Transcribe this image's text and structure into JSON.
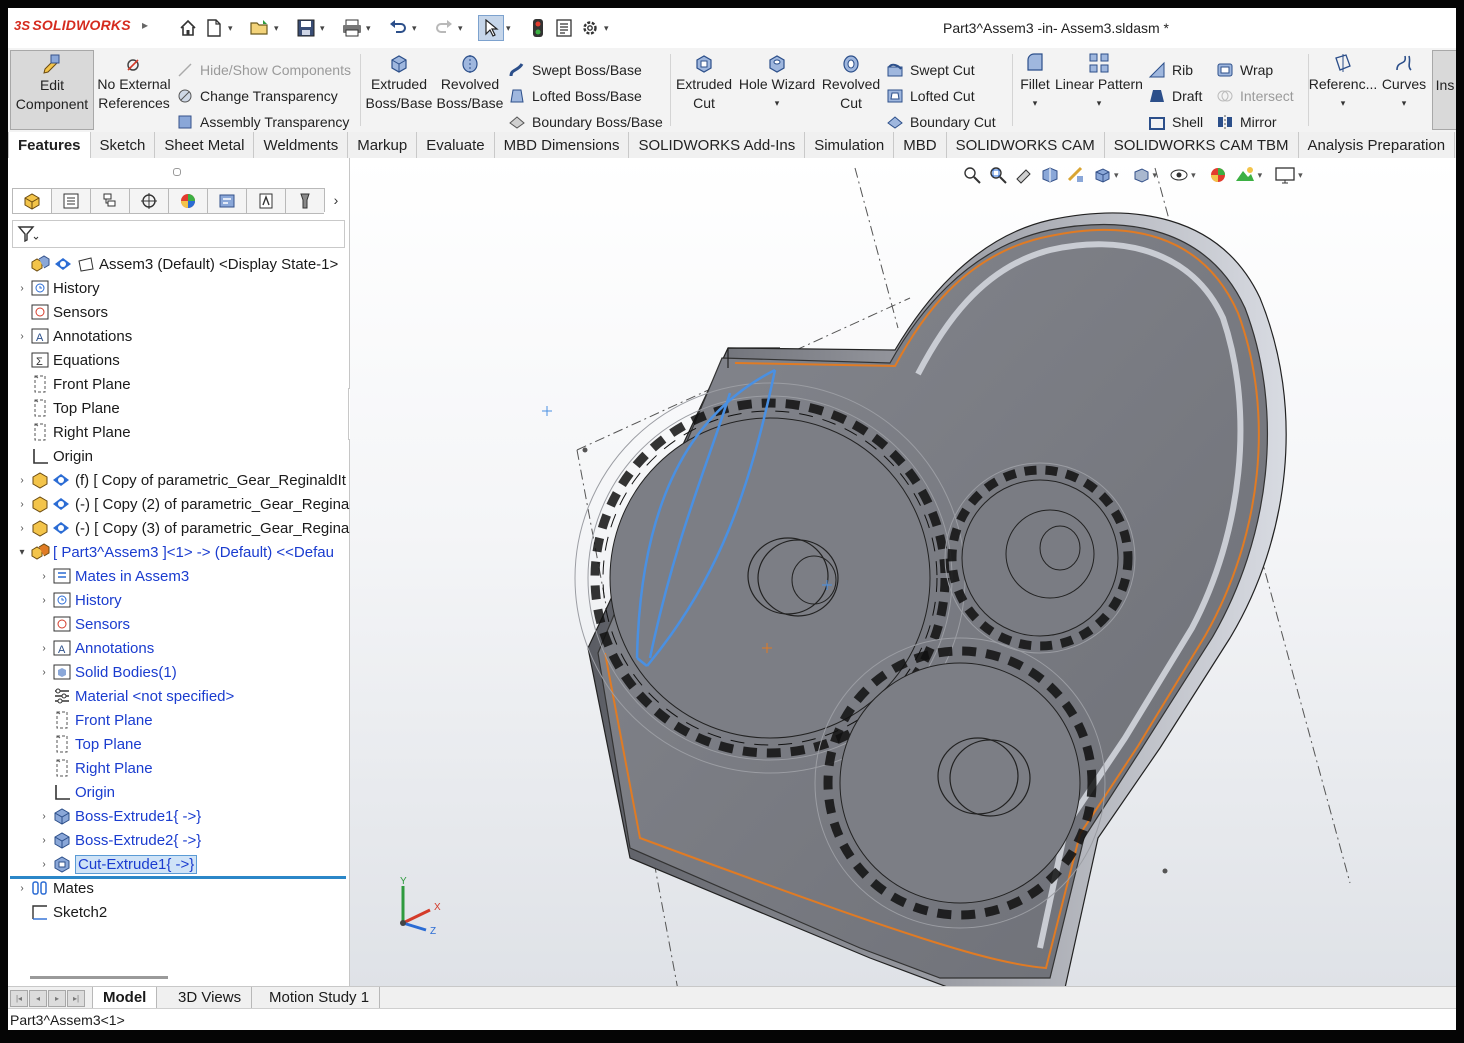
{
  "app": {
    "brand": "SOLIDWORKS",
    "window_title": "Part3^Assem3 -in- Assem3.sldasm *"
  },
  "ribbon": {
    "edit_component": [
      "Edit",
      "Component"
    ],
    "no_external_refs": [
      "No External",
      "References"
    ],
    "hide_show": "Hide/Show Components",
    "change_transparency": "Change Transparency",
    "assembly_transparency": "Assembly Transparency",
    "extruded_boss": [
      "Extruded",
      "Boss/Base"
    ],
    "revolved_boss": [
      "Revolved",
      "Boss/Base"
    ],
    "swept_boss": "Swept Boss/Base",
    "lofted_boss": "Lofted Boss/Base",
    "boundary_boss": "Boundary Boss/Base",
    "extruded_cut": [
      "Extruded",
      "Cut"
    ],
    "hole_wizard": "Hole Wizard",
    "revolved_cut": [
      "Revolved",
      "Cut"
    ],
    "swept_cut": "Swept Cut",
    "lofted_cut": "Lofted Cut",
    "boundary_cut": "Boundary Cut",
    "fillet": "Fillet",
    "linear_pattern": "Linear Pattern",
    "rib": "Rib",
    "wrap": "Wrap",
    "draft": "Draft",
    "intersect": "Intersect",
    "shell": "Shell",
    "mirror": "Mirror",
    "reference": "Referenc...",
    "curves": "Curves",
    "insert_cut": "Ins"
  },
  "command_tabs": [
    "Features",
    "Sketch",
    "Sheet Metal",
    "Weldments",
    "Markup",
    "Evaluate",
    "MBD Dimensions",
    "SOLIDWORKS Add-Ins",
    "Simulation",
    "MBD",
    "SOLIDWORKS CAM",
    "SOLIDWORKS CAM TBM",
    "Analysis Preparation"
  ],
  "tree": {
    "root": "Assem3 (Default) <Display State-1>",
    "history": "History",
    "sensors": "Sensors",
    "annotations": "Annotations",
    "equations": "Equations",
    "front_plane": "Front Plane",
    "top_plane": "Top Plane",
    "right_plane": "Right Plane",
    "origin": "Origin",
    "copy1": "(f) [ Copy of parametric_Gear_ReginaldIt",
    "copy2": "(-) [ Copy (2) of parametric_Gear_Regina",
    "copy3": "(-) [ Copy (3) of parametric_Gear_Regina",
    "part3": "[ Part3^Assem3 ]<1> -> (Default) <<Defau",
    "mates_in": "Mates in Assem3",
    "p_history": "History",
    "p_sensors": "Sensors",
    "p_annotations": "Annotations",
    "solid_bodies": "Solid Bodies(1)",
    "material": "Material <not specified>",
    "p_front": "Front Plane",
    "p_top": "Top Plane",
    "p_right": "Right Plane",
    "p_origin": "Origin",
    "boss1": "Boss-Extrude1{ ->}",
    "boss2": "Boss-Extrude2{ ->}",
    "cut1": "Cut-Extrude1{ ->}",
    "mates": "Mates",
    "sketch2": "Sketch2"
  },
  "bottom_tabs": [
    "Model",
    "3D Views",
    "Motion Study 1"
  ],
  "status_bar": "Part3^Assem3<1>",
  "triad": {
    "x": "X",
    "y": "Y",
    "z": "Z"
  },
  "colors": {
    "accent_blue": "#1a3ccf",
    "selection_blue": "#2b87c8",
    "sketch_orange": "#e07b24"
  }
}
